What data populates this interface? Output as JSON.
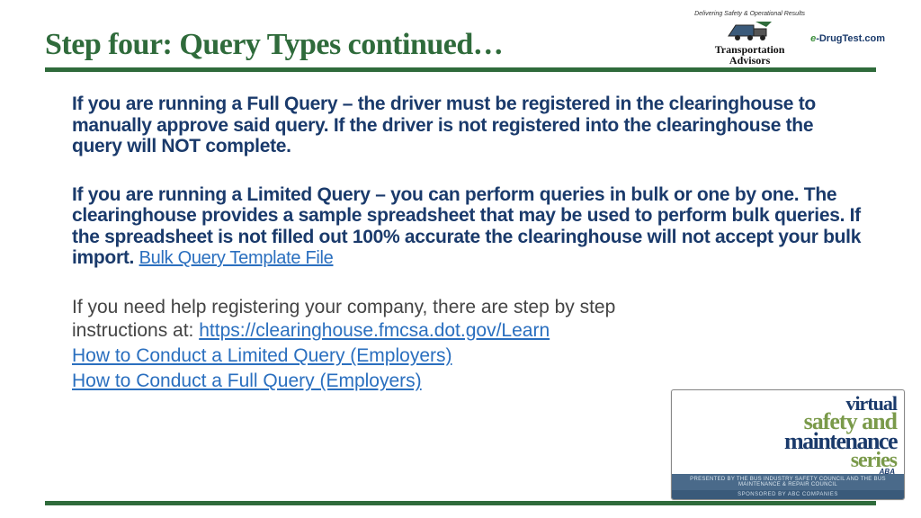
{
  "title": "Step four: Query Types continued…",
  "logo": {
    "arc_text": "Delivering Safety & Operational Results",
    "trans": "Transportation",
    "advisors": "Advisors",
    "ez_prefix": "e",
    "ez_rest": "-DrugTest.com"
  },
  "para_full": "If you are running a Full Query – the driver must be registered in the clearinghouse to manually approve said query. If the driver is not registered into the clearinghouse the query will NOT complete.",
  "para_limited": "If you are running a Limited Query – you can perform queries in bulk or one by one. The clearinghouse provides a sample spreadsheet that may be used to perform bulk queries. If the spreadsheet is not filled out 100% accurate the clearinghouse will not accept your bulk import. ",
  "link_bulk": "Bulk Query Template File",
  "help_text": "If you need help registering your company, there are step by step instructions at: ",
  "link_learn": "https://clearinghouse.fmcsa.dot.gov/Learn",
  "link_limited": " How to Conduct a Limited Query (Employers)",
  "link_full": "How to Conduct a Full Query (Employers)",
  "badge": {
    "virtual": "virtual",
    "safety": "safety and",
    "maint": "maintenance",
    "series": "series",
    "presented": "PRESENTED BY THE BUS INDUSTRY SAFETY COUNCIL AND THE BUS MAINTENANCE & REPAIR COUNCIL",
    "sponsor": "SPONSORED BY ABC COMPANIES",
    "aba": "ABA"
  }
}
